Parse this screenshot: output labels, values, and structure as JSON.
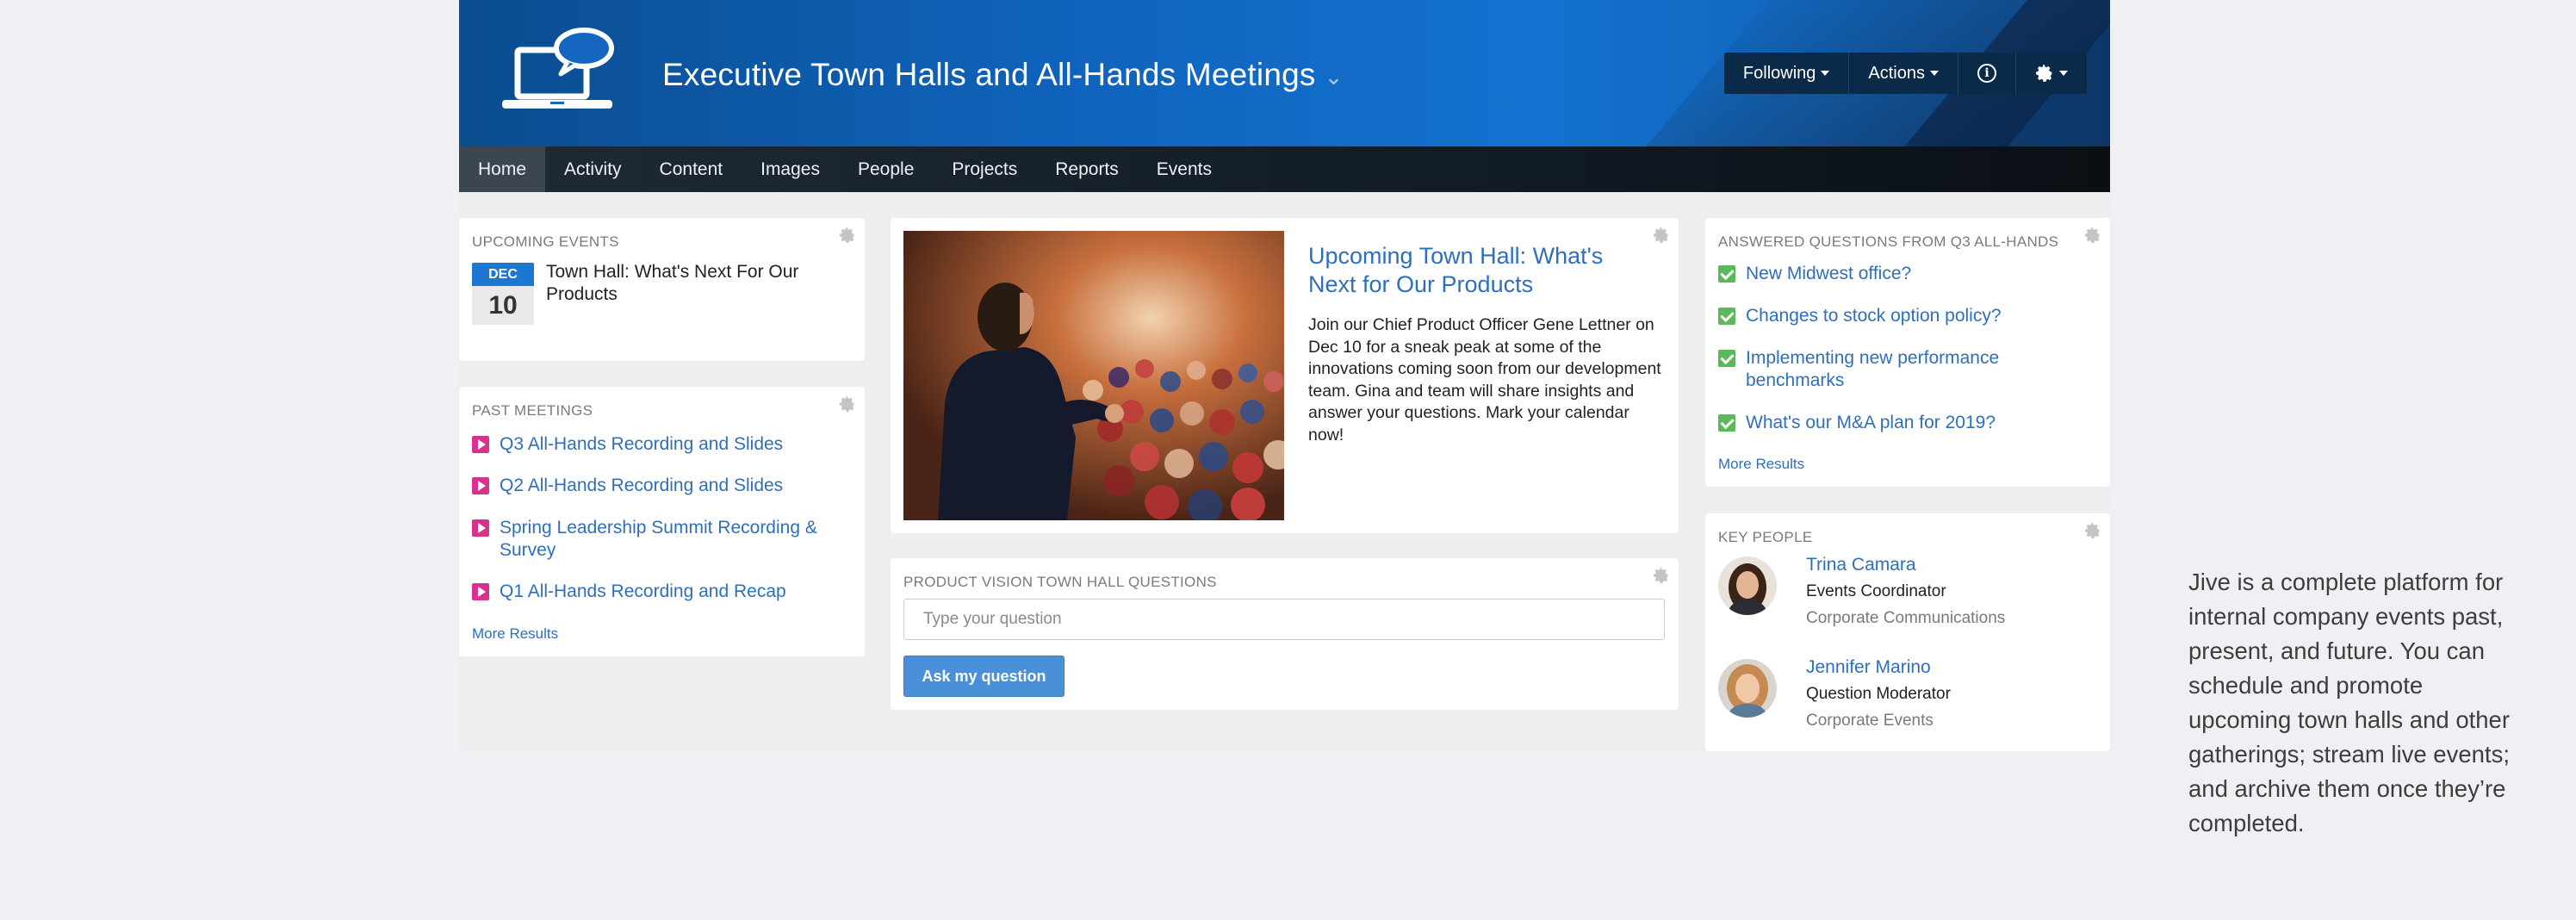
{
  "banner": {
    "title": "Executive Town Halls and All-Hands Meetings",
    "buttons": [
      {
        "label": "Following"
      },
      {
        "label": "Actions"
      }
    ]
  },
  "nav": {
    "items": [
      "Home",
      "Activity",
      "Content",
      "Images",
      "People",
      "Projects",
      "Reports",
      "Events"
    ],
    "active": "Home"
  },
  "upcoming_events": {
    "heading": "UPCOMING EVENTS",
    "event": {
      "month": "DEC",
      "day": "10",
      "title": "Town Hall: What's Next For Our Products"
    }
  },
  "past_meetings": {
    "heading": "PAST MEETINGS",
    "items": [
      "Q3 All-Hands Recording and Slides",
      "Q2 All-Hands Recording and Slides",
      "Spring Leadership Summit Recording & Survey",
      "Q1 All-Hands Recording and Recap"
    ],
    "more": "More Results"
  },
  "featured": {
    "title": "Upcoming Town Hall: What's Next for Our Products",
    "body": "Join our Chief Product Officer Gene Lettner on Dec 10 for a sneak peak at some of the innovations coming soon from our development team. Gina and team will share insights and answer your questions. Mark your calendar now!"
  },
  "questions": {
    "heading": "PRODUCT VISION TOWN HALL QUESTIONS",
    "placeholder": "Type your question",
    "button": "Ask my question"
  },
  "answered": {
    "heading": "ANSWERED QUESTIONS FROM Q3 ALL-HANDS",
    "items": [
      "New Midwest office?",
      "Changes to stock option policy?",
      "Implementing new performance benchmarks",
      "What's our M&A plan for 2019?"
    ],
    "more": "More Results"
  },
  "key_people": {
    "heading": "KEY PEOPLE",
    "people": [
      {
        "name": "Trina Camara",
        "role": "Events Coordinator",
        "dept": "Corporate Communications"
      },
      {
        "name": "Jennifer Marino",
        "role": "Question Moderator",
        "dept": "Corporate Events"
      }
    ]
  },
  "caption": "Jive is a complete platform for internal company events past, present, and future. You can schedule and promote upcoming town halls and other gatherings; stream live events; and archive them once they’re completed.",
  "colors": {
    "banner_blue": "#1472d0",
    "nav_dark": "#111c27",
    "link": "#2f6fba",
    "play_magenta": "#d9328e",
    "check_green": "#5cb85c",
    "ask_button": "#4a90d9"
  }
}
